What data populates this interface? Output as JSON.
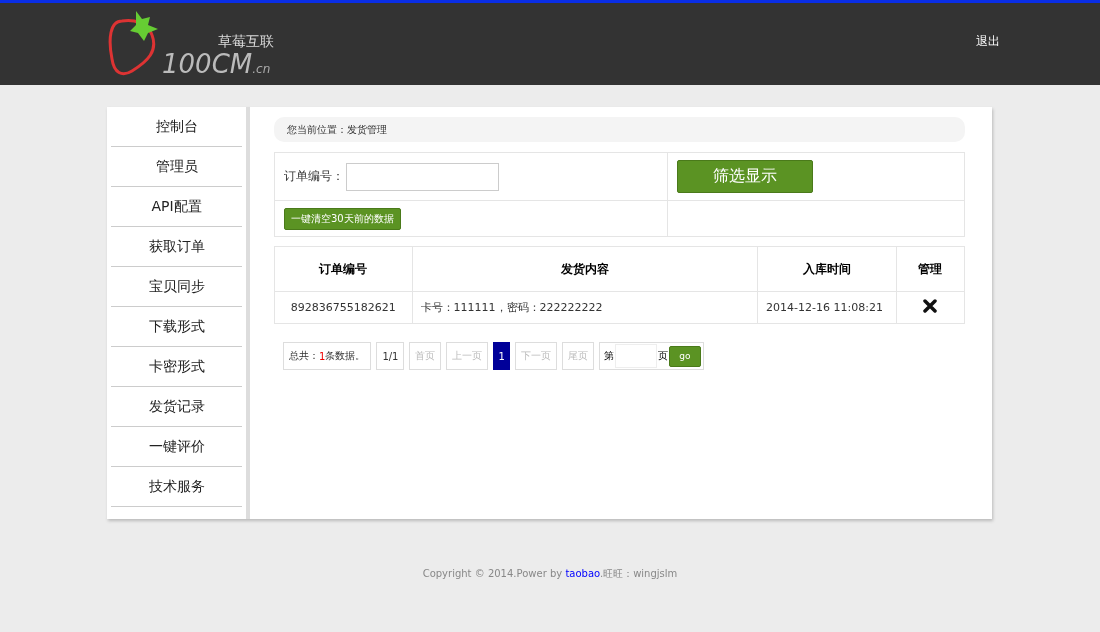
{
  "header": {
    "logo_cn": "草莓互联",
    "logo_main": "100CM",
    "logo_suffix": ".cn",
    "logout": "退出"
  },
  "sidebar": {
    "items": [
      {
        "label": "控制台",
        "selected": false
      },
      {
        "label": "管理员",
        "selected": false
      },
      {
        "label": "API配置",
        "selected": false
      },
      {
        "label": "获取订单",
        "selected": false
      },
      {
        "label": "宝贝同步",
        "selected": false
      },
      {
        "label": "下载形式",
        "selected": false
      },
      {
        "label": "卡密形式",
        "selected": false
      },
      {
        "label": "发货记录",
        "selected": false
      },
      {
        "label": "一键评价",
        "selected": false
      },
      {
        "label": "技术服务",
        "selected": false
      }
    ]
  },
  "breadcrumb": "您当前位置：发货管理",
  "filter": {
    "label": "订单编号：",
    "submit": "筛选显示",
    "clear": "一键清空30天前的数据"
  },
  "table": {
    "columns": [
      "订单编号",
      "发货内容",
      "入库时间",
      "管理"
    ],
    "rows": [
      {
        "order_no": "892836755182621",
        "content": "卡号：111111，密码：222222222",
        "time": "2014-12-16 11:08:21"
      }
    ]
  },
  "pagination": {
    "total_prefix": "总共：",
    "total_count": "1",
    "total_suffix": "条数据。",
    "pages": "1/1",
    "items": [
      {
        "kind": "link",
        "label": "首页",
        "disabled": true
      },
      {
        "kind": "link",
        "label": "上一页",
        "disabled": true
      },
      {
        "kind": "page",
        "label": "1",
        "selected": true
      },
      {
        "kind": "link",
        "label": "下一页",
        "disabled": true
      },
      {
        "kind": "link",
        "label": "尾页",
        "disabled": true
      }
    ],
    "jump_prefix": "第",
    "jump_suffix": "页",
    "go": "go"
  },
  "footer": {
    "before": "Copyright © 2014.Power by ",
    "link": "taobao",
    "after": ".旺旺：wingjslm"
  }
}
